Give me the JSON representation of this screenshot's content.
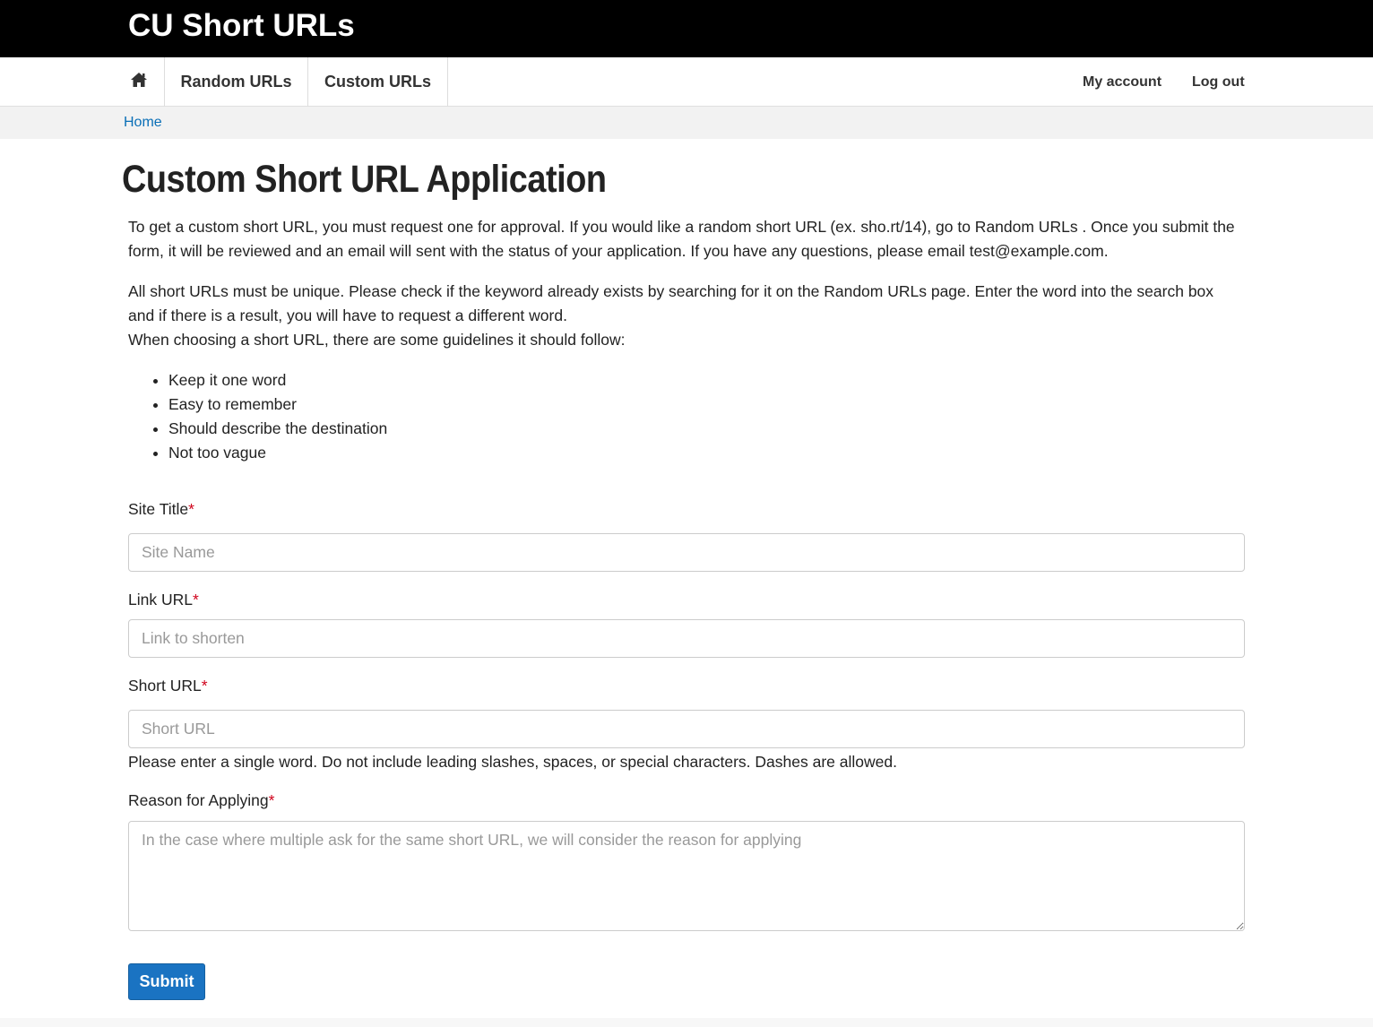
{
  "header": {
    "site_title": "CU Short URLs"
  },
  "nav": {
    "home_icon": "home-icon",
    "items": [
      {
        "label": "Random URLs"
      },
      {
        "label": "Custom URLs"
      }
    ],
    "right_items": [
      {
        "label": "My account"
      },
      {
        "label": "Log out"
      }
    ]
  },
  "breadcrumb": {
    "home": "Home"
  },
  "page": {
    "title": "Custom Short URL Application",
    "intro": "To get a custom short URL, you must request one for approval. If you would like a random short URL (ex. sho.rt/14), go to Random URLs . Once you submit the form, it will be reviewed and an email will sent with the status of your application. If you have any questions, please email test@example.com.",
    "unique_note": "All short URLs must be unique. Please check if the keyword already exists by searching for it on the Random URLs page. Enter the word into the search box and if there is a result, you will have to request a different word.",
    "guidelines_intro": "When choosing a short URL, there are some guidelines it should follow:",
    "guidelines": [
      "Keep it one word",
      "Easy to remember",
      "Should describe the destination",
      "Not too vague"
    ]
  },
  "form": {
    "required_marker": "*",
    "site_title": {
      "label": "Site Title",
      "placeholder": "Site Name",
      "value": ""
    },
    "link_url": {
      "label": "Link URL",
      "placeholder": "Link to shorten",
      "value": ""
    },
    "short_url": {
      "label": "Short URL",
      "placeholder": "Short URL",
      "value": "",
      "help": "Please enter a single word. Do not include leading slashes, spaces, or special characters. Dashes are allowed."
    },
    "reason": {
      "label": "Reason for Applying",
      "placeholder": "In the case where multiple ask for the same short URL, we will consider the reason for applying",
      "value": ""
    },
    "submit_label": "Submit"
  },
  "colors": {
    "header_bg": "#000000",
    "link": "#0a6fb7",
    "required": "#d0021b",
    "button": "#1a73c2"
  }
}
